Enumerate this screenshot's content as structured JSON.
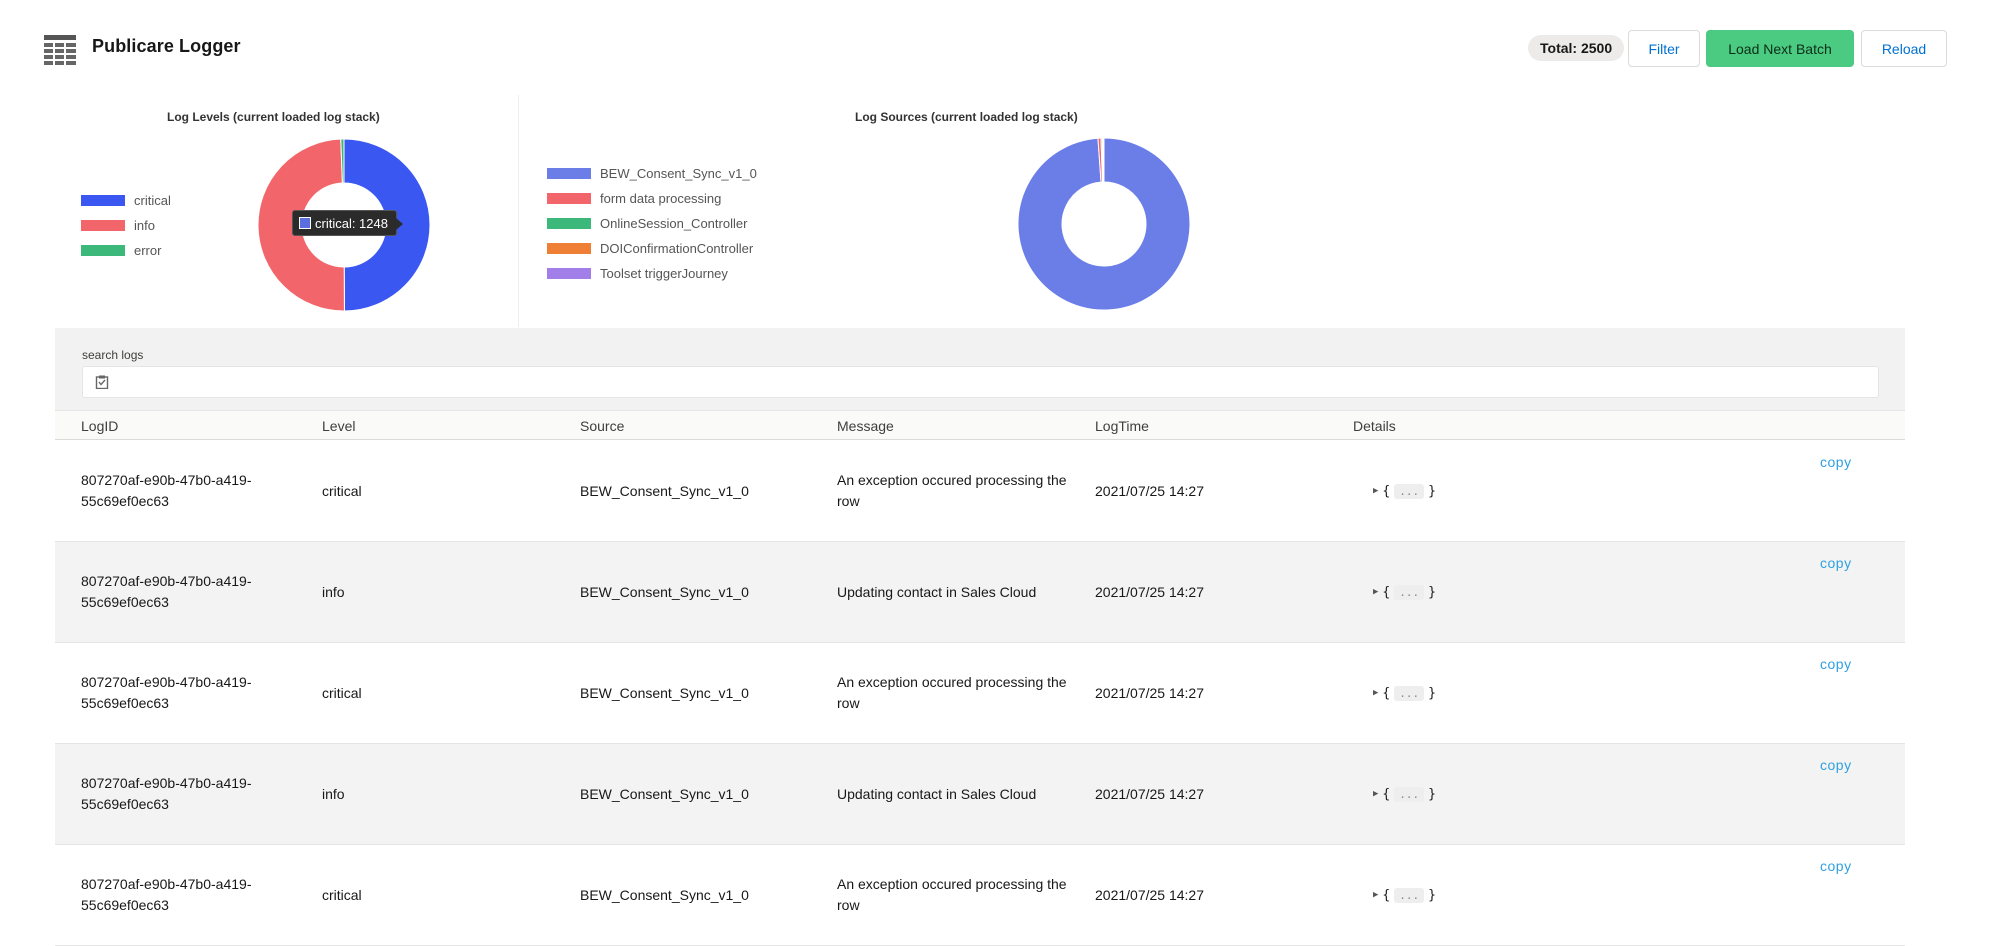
{
  "header": {
    "title": "Publicare Logger",
    "total_label": "Total: 2500",
    "filter_label": "Filter",
    "load_next_label": "Load Next Batch",
    "reload_label": "Reload"
  },
  "charts": {
    "levels_title": "Log Levels (current loaded log stack)",
    "sources_title": "Log Sources (current loaded log stack)",
    "tooltip_text": "critical: 1248"
  },
  "chart_data": [
    {
      "type": "pie",
      "title": "Log Levels (current loaded log stack)",
      "legend": "left",
      "slices": [
        {
          "label": "critical",
          "value": 1248,
          "color": "#3b57f2"
        },
        {
          "label": "info",
          "value": 1237,
          "color": "#f2666b"
        },
        {
          "label": "error",
          "value": 15,
          "color": "#3bb87a"
        }
      ]
    },
    {
      "type": "pie",
      "title": "Log Sources (current loaded log stack)",
      "legend": "left",
      "slices": [
        {
          "label": "BEW_Consent_Sync_v1_0",
          "value": 2472,
          "color": "#6b7ee8"
        },
        {
          "label": "form data processing",
          "value": 14,
          "color": "#f2666b"
        },
        {
          "label": "OnlineSession_Controller",
          "value": 6,
          "color": "#3bb87a"
        },
        {
          "label": "DOIConfirmationController",
          "value": 5,
          "color": "#ef7f35"
        },
        {
          "label": "Toolset triggerJourney",
          "value": 3,
          "color": "#a27ee8"
        }
      ]
    }
  ],
  "search": {
    "label": "search logs",
    "value": "",
    "placeholder": ""
  },
  "table": {
    "columns": [
      "LogID",
      "Level",
      "Source",
      "Message",
      "LogTime",
      "Details"
    ],
    "copy_label": "copy",
    "details_brace_open": "{",
    "details_ellipsis": "...",
    "details_brace_close": "}",
    "rows": [
      {
        "id": "807270af-e90b-47b0-a419-55c69ef0ec63",
        "level": "critical",
        "source": "BEW_Consent_Sync_v1_0",
        "message": "An exception occured processing the row",
        "time": "2021/07/25 14:27"
      },
      {
        "id": "807270af-e90b-47b0-a419-55c69ef0ec63",
        "level": "info",
        "source": "BEW_Consent_Sync_v1_0",
        "message": "Updating contact in Sales Cloud",
        "time": "2021/07/25 14:27"
      },
      {
        "id": "807270af-e90b-47b0-a419-55c69ef0ec63",
        "level": "critical",
        "source": "BEW_Consent_Sync_v1_0",
        "message": "An exception occured processing the row",
        "time": "2021/07/25 14:27"
      },
      {
        "id": "807270af-e90b-47b0-a419-55c69ef0ec63",
        "level": "info",
        "source": "BEW_Consent_Sync_v1_0",
        "message": "Updating contact in Sales Cloud",
        "time": "2021/07/25 14:27"
      },
      {
        "id": "807270af-e90b-47b0-a419-55c69ef0ec63",
        "level": "critical",
        "source": "BEW_Consent_Sync_v1_0",
        "message": "An exception occured processing the row",
        "time": "2021/07/25 14:27"
      }
    ]
  }
}
